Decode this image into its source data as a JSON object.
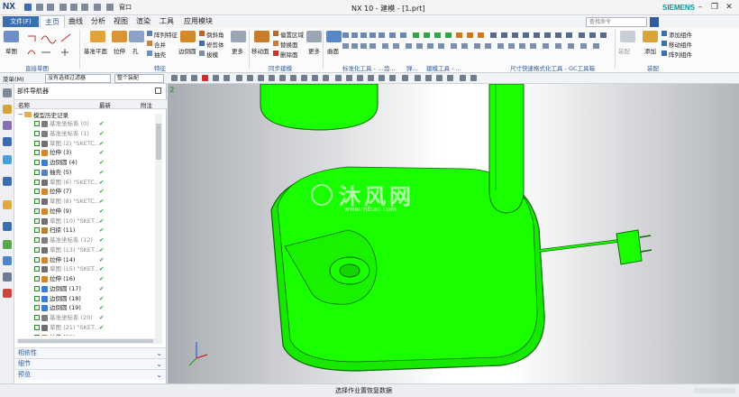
{
  "app": {
    "logo": "NX",
    "title": "NX 10 - 建模 - [1.prt]",
    "brand": "SIEMENS",
    "window_menu": "窗口"
  },
  "menus": [
    "文件(F)",
    "主页",
    "曲线",
    "分析",
    "视图",
    "渲染",
    "工具",
    "应用模块"
  ],
  "search": {
    "placeholder": "查找命令"
  },
  "ribbon": {
    "sketch": "草图",
    "datum_plane": "基准平面",
    "extrude": "拉伸",
    "hole": "孔",
    "pattern_feature": "阵列特征",
    "unite": "合并",
    "shell": "抽壳",
    "edge_blend": "边倒圆",
    "chamfer": "倒斜角",
    "trim_body": "修剪体",
    "draft": "拔模",
    "more1": "更多",
    "move_face": "移动面",
    "offset_region": "偏置区域",
    "replace_face": "替换面",
    "delete_face": "删除面",
    "more2": "更多",
    "surface": "曲面",
    "assemble": "装配",
    "add": "添加",
    "add_component": "添加组件",
    "move_component": "移动组件",
    "pattern_component": "阵列组件",
    "groups": {
      "direct_sketch": "直接草图",
      "feature": "特征",
      "sync_model": "同步建模",
      "std_tools": "标准化工具 - ...",
      "gear": "齿...",
      "spring": "弹...",
      "build_tools": "建模工具 - ...",
      "size_tools": "尺寸快速格式化工具 - GC工具箱",
      "assembly": "装配"
    }
  },
  "selbar": {
    "menu": "菜单(M)",
    "filter": "没有选择过滤器",
    "scope": "整个装配"
  },
  "navigator": {
    "title": "部件导航器",
    "columns": {
      "name": "名称",
      "latest": "最新",
      "note": "附注"
    },
    "root": "模型历史记录",
    "items": [
      {
        "label": "基准坐标系 (0)",
        "kind": "datum",
        "suppressed": true
      },
      {
        "label": "基准坐标系 (1)",
        "kind": "datum",
        "suppressed": true
      },
      {
        "label": "草图 (2) \"SKETC...",
        "kind": "sketch",
        "suppressed": true
      },
      {
        "label": "拉伸 (3)",
        "kind": "extrude",
        "suppressed": false
      },
      {
        "label": "边倒圆 (4)",
        "kind": "blend",
        "suppressed": false
      },
      {
        "label": "抽壳 (5)",
        "kind": "shell",
        "suppressed": false
      },
      {
        "label": "草图 (6) \"SKETC...",
        "kind": "sketch",
        "suppressed": true
      },
      {
        "label": "拉伸 (7)",
        "kind": "extrude",
        "suppressed": false
      },
      {
        "label": "草图 (8) \"SKETC...",
        "kind": "sketch",
        "suppressed": true
      },
      {
        "label": "拉伸 (9)",
        "kind": "extrude",
        "suppressed": false
      },
      {
        "label": "草图 (10) \"SKET...",
        "kind": "sketch",
        "suppressed": true
      },
      {
        "label": "扫掠 (11)",
        "kind": "sweep",
        "suppressed": false
      },
      {
        "label": "基准坐标系 (12)",
        "kind": "datum",
        "suppressed": true
      },
      {
        "label": "草图 (13) \"SKET...",
        "kind": "sketch",
        "suppressed": true
      },
      {
        "label": "拉伸 (14)",
        "kind": "extrude",
        "suppressed": false
      },
      {
        "label": "草图 (15) \"SKET...",
        "kind": "sketch",
        "suppressed": true
      },
      {
        "label": "拉伸 (16)",
        "kind": "extrude",
        "suppressed": false
      },
      {
        "label": "边倒圆 (17)",
        "kind": "blend",
        "suppressed": false
      },
      {
        "label": "边倒圆 (18)",
        "kind": "blend",
        "suppressed": false
      },
      {
        "label": "边倒圆 (19)",
        "kind": "blend",
        "suppressed": false
      },
      {
        "label": "基准坐标系 (20)",
        "kind": "datum",
        "suppressed": true
      },
      {
        "label": "草图 (21) \"SKET...",
        "kind": "sketch",
        "suppressed": true
      },
      {
        "label": "拉伸 (22)",
        "kind": "extrude",
        "suppressed": false
      }
    ],
    "panes": [
      "相依性",
      "细节",
      "预览"
    ]
  },
  "viewport": {
    "watermark_text": "沐风网",
    "watermark_url": "www.mfcad.com",
    "wcs_label": "2"
  },
  "status": "选择作业置恢复数据",
  "colors": {
    "model": "#1aff00",
    "model_edge": "#0a6a00",
    "accent": "#2d5da3",
    "check": "#2e9a2e",
    "wordmark": "#009999"
  }
}
